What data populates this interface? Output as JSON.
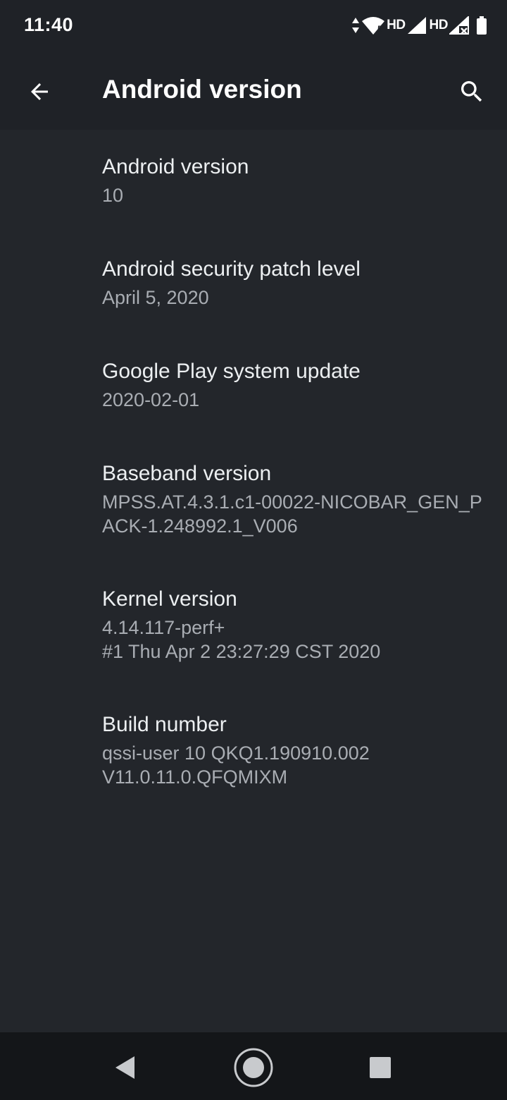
{
  "status_bar": {
    "time": "11:40",
    "hd_1": "HD",
    "hd_2": "HD",
    "wifi_sub": "5"
  },
  "app_bar": {
    "title": "Android version",
    "back_icon": "arrow-back-icon",
    "search_icon": "search-icon"
  },
  "items": [
    {
      "title": "Android version",
      "summary": "10"
    },
    {
      "title": "Android security patch level",
      "summary": "April 5, 2020"
    },
    {
      "title": "Google Play system update",
      "summary": "2020-02-01"
    },
    {
      "title": "Baseband version",
      "summary": "MPSS.AT.4.3.1.c1-00022-NICOBAR_GEN_P\nACK-1.248992.1_V006"
    },
    {
      "title": "Kernel version",
      "summary": "4.14.117-perf+\n#1 Thu Apr 2 23:27:29 CST 2020"
    },
    {
      "title": "Build number",
      "summary": "qssi-user 10 QKQ1.190910.002\nV11.0.11.0.QFQMIXM"
    }
  ],
  "nav_bar": {
    "back_icon": "nav-back-icon",
    "home_icon": "nav-home-icon",
    "recents_icon": "nav-recents-icon"
  },
  "colors": {
    "background": "#23262b",
    "app_bar": "#1f2227",
    "title_text": "#eceff1",
    "summary_text": "#a9adb3",
    "nav_bar": "#141619"
  }
}
